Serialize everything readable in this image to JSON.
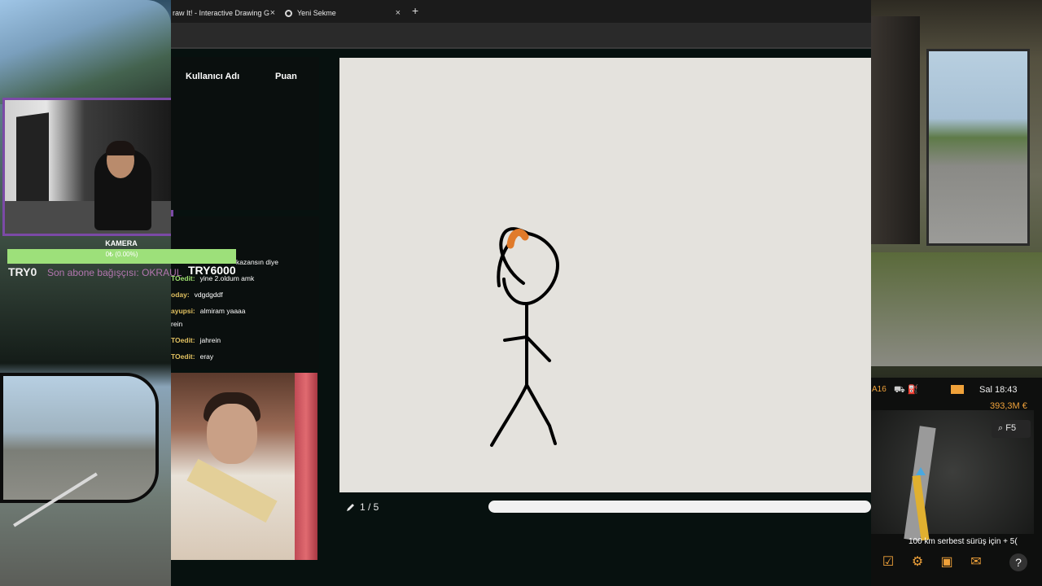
{
  "browser": {
    "tabs": [
      {
        "label": "raw It! - Interactive Drawing G",
        "active": true
      },
      {
        "label": "Yeni Sekme",
        "active": false
      }
    ],
    "close_glyph": "×",
    "new_tab_glyph": "+"
  },
  "stream_overlay": {
    "camera_label": "KAMERA",
    "goal_progress_text": "0₺ (0.00%)",
    "goal_progress_fraction": 0.0,
    "goal_left": "TRY0",
    "goal_right": "TRY6000",
    "last_donor": "Son abone bağışçısı: OKRAUL"
  },
  "scoreboard": {
    "col_user": "Kullanıcı Adı",
    "col_score": "Puan"
  },
  "chat": [
    {
      "user": "",
      "text": "kazansın diye"
    },
    {
      "user": "TOedit:",
      "text": "yine 2.oldum amk"
    },
    {
      "user": "oday:",
      "text": "vdgdgddf"
    },
    {
      "user": "ayupsi:",
      "text": "almiram yaaaa"
    },
    {
      "user": "",
      "text": "rein"
    },
    {
      "user": "TOedit:",
      "text": "jahrein"
    },
    {
      "user": "TOedit:",
      "text": "eray"
    }
  ],
  "drawing": {
    "round_text": "1 / 5",
    "timer_fraction": 1.0,
    "stroke_color": "#000000",
    "accent_color": "#e07a2a",
    "canvas_color": "#e4e2dd"
  },
  "game_hud": {
    "vehicle_id": "A16",
    "time": "Sal 18:43",
    "money": "393,3M €",
    "map_key": "F5",
    "info": "100 km serbest sürüş için + 5(",
    "accent_color": "#f0a23a"
  }
}
